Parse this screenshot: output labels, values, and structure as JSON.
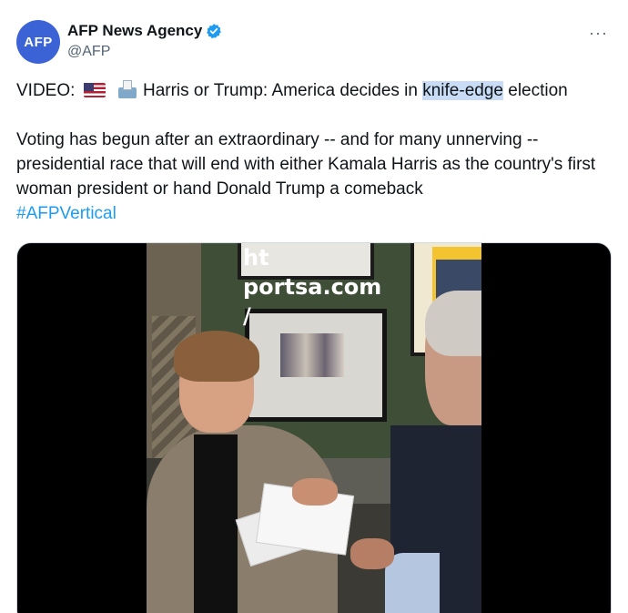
{
  "author": {
    "avatar_text": "AFP",
    "display_name": "AFP News Agency",
    "handle": "@AFP",
    "verified_icon": "verified-badge-icon",
    "verified_color": "#1d9bf0"
  },
  "more_label": "···",
  "tweet": {
    "line1_prefix": "VIDEO:",
    "line1_main": "Harris or Trump: America decides in ",
    "line1_highlight": "knife-edge",
    "line1_suffix": " election",
    "paragraph2": "Voting has begun after an extraordinary -- and for many unnerving -- presidential race that will end with either Kamala Harris as the country's first woman president or hand Donald Trump a comeback",
    "hashtag": "#AFPVertical",
    "emoji_icons": [
      "us-flag-icon",
      "ballot-box-icon"
    ]
  },
  "media": {
    "watermark_lines": [
      "ht",
      "portsa.com",
      "/"
    ]
  },
  "colors": {
    "link": "#1d9bf0",
    "avatar_bg": "#3b63d6",
    "highlight": "#c8dcf5"
  }
}
